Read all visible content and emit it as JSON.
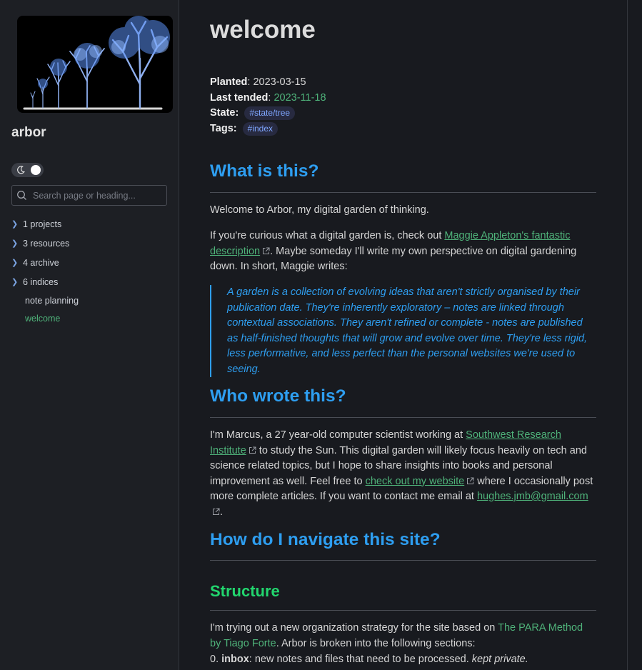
{
  "sidebar": {
    "site_title": "arbor",
    "search_placeholder": "Search page or heading...",
    "folders": [
      {
        "label": "1 projects"
      },
      {
        "label": "3 resources"
      },
      {
        "label": "4 archive"
      },
      {
        "label": "6 indices"
      }
    ],
    "pages": [
      {
        "label": "note planning"
      },
      {
        "label": "welcome",
        "active": true
      }
    ]
  },
  "page": {
    "title": "welcome",
    "meta": {
      "planted_label": "Planted",
      "planted_value": "2023-03-15",
      "tended_label": "Last tended",
      "tended_value": "2023-11-18",
      "state_label": "State",
      "state_tag": "#state/tree",
      "tags_label": "Tags",
      "tags_tag": "#index"
    },
    "h_what": "What is this?",
    "p_welcome": "Welcome to Arbor, my digital garden of thinking.",
    "p_curious_1": "If you're curious what a digital garden is, check out ",
    "link_maggie": "Maggie Appleton's fantastic description",
    "p_curious_2": ". Maybe someday I'll write my own perspective on digital gardening down. In short, Maggie writes:",
    "quote": "A garden is a collection of evolving ideas that aren't strictly organised by their publication date. They're inherently exploratory – notes are linked through contextual associations. They aren't refined or complete - notes are published as half-finished thoughts that will grow and evolve over time. They're less rigid, less performative, and less perfect than the personal websites we're used to seeing.",
    "h_who": "Who wrote this?",
    "p_who_1": "I'm Marcus, a 27 year-old computer scientist working at ",
    "link_swri": "Southwest Research Institute",
    "p_who_2": " to study the Sun. This digital garden will likely focus heavily on tech and science related topics, but I hope to share insights into books and personal improvement as well. Feel free to ",
    "link_website": "check out my website",
    "p_who_3": " where I occasionally post more complete articles. If you want to contact me email at ",
    "link_email": "hughes.jmb@gmail.com",
    "p_who_4": ".",
    "h_navigate": "How do I navigate this site?",
    "h_structure": "Structure",
    "p_struct_1": "I'm trying out a new organization strategy for the site based on ",
    "link_para": "The PARA Method by Tiago Forte",
    "p_struct_2": ". Arbor is broken into the following sections:",
    "list_0_num": "0. ",
    "list_0_term": "inbox",
    "list_0_text": ": new notes and files that need to be processed. ",
    "list_0_note": "kept private."
  },
  "colors": {
    "background": "#181a1f",
    "sidebar": "#1d1f24",
    "heading_blue": "#2e9ef0",
    "heading_green": "#22d66e",
    "link_green": "#4fb37a",
    "tag_text": "#7fa6ff"
  }
}
